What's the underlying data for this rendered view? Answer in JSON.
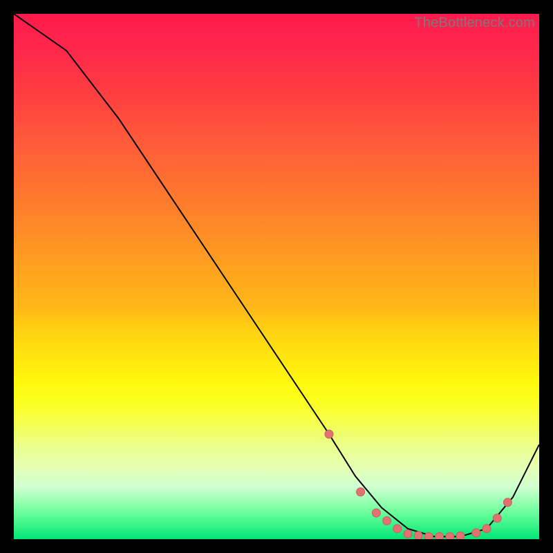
{
  "watermark": "TheBottleneck.com",
  "colors": {
    "line": "#000000",
    "marker_fill": "#e07272",
    "marker_stroke": "#c96060"
  },
  "chart_data": {
    "type": "line",
    "title": "",
    "xlabel": "",
    "ylabel": "",
    "xlim": [
      0,
      100
    ],
    "ylim": [
      0,
      100
    ],
    "series": [
      {
        "name": "bottleneck-curve",
        "x": [
          0,
          10,
          20,
          30,
          40,
          50,
          60,
          65,
          70,
          75,
          80,
          85,
          90,
          95,
          100
        ],
        "values": [
          100,
          93,
          80,
          65,
          50,
          35,
          20,
          12,
          6,
          2,
          0.5,
          0.5,
          2,
          8,
          18
        ]
      }
    ],
    "markers": {
      "name": "highlight-points",
      "x": [
        60,
        66,
        69,
        71,
        73,
        75,
        77,
        79,
        81,
        83,
        85,
        88,
        90,
        92,
        94
      ],
      "values": [
        20,
        9,
        5,
        3.5,
        2,
        1,
        0.7,
        0.5,
        0.5,
        0.5,
        0.6,
        1.2,
        2,
        4,
        7
      ]
    }
  }
}
